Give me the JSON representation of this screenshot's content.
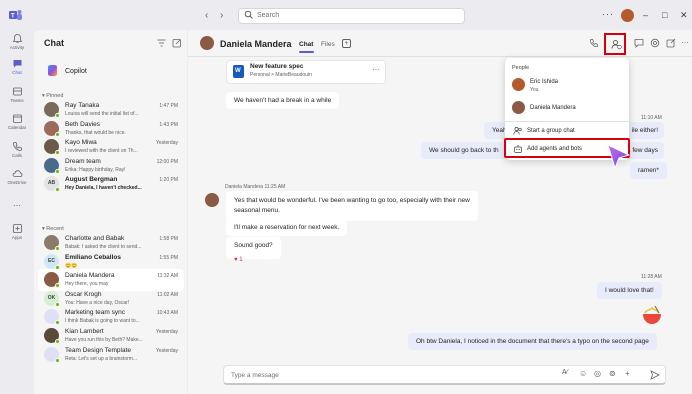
{
  "titlebar": {
    "search_placeholder": "Search",
    "more": "···",
    "win_min": "–",
    "win_max": "□",
    "win_close": "✕",
    "back": "‹",
    "forward": "›"
  },
  "rail": {
    "items": [
      {
        "label": "Activity",
        "icon": "bell-icon"
      },
      {
        "label": "Chat",
        "icon": "chat-icon"
      },
      {
        "label": "Teams",
        "icon": "teams-icon"
      },
      {
        "label": "Calendar",
        "icon": "calendar-icon"
      },
      {
        "label": "Calls",
        "icon": "phone-icon"
      },
      {
        "label": "OneDrive",
        "icon": "cloud-icon"
      },
      {
        "label": "···",
        "icon": "more-icon"
      },
      {
        "label": "Apps",
        "icon": "apps-icon"
      }
    ]
  },
  "chatlist": {
    "title": "Chat",
    "copilot": "Copilot",
    "pinned_header": "Pinned",
    "recent_header": "Recent",
    "chevron": "▾",
    "pinned": [
      {
        "name": "Ray Tanaka",
        "preview": "Louisa will send the initial list of...",
        "time": "1:47 PM",
        "color": "#7a6a5a",
        "initials": ""
      },
      {
        "name": "Beth Davies",
        "preview": "Thanks, that would be nice.",
        "time": "1:43 PM",
        "color": "#9c6b5a",
        "initials": ""
      },
      {
        "name": "Kayo Miwa",
        "preview": "I reviewed with the client on Th...",
        "time": "Yesterday",
        "color": "#6a5a4a",
        "initials": ""
      },
      {
        "name": "Dream team",
        "preview": "Erika: Happy birthday, Ray!",
        "time": "12:00 PM",
        "color": "#4a6a8a",
        "initials": ""
      },
      {
        "name": "August Bergman",
        "preview": "Hey Daniela, I haven't checked...",
        "time": "1:20 PM",
        "color": "#e3e3e3",
        "initials": "AB",
        "bold": true
      }
    ],
    "recent": [
      {
        "name": "Charlotte and Babak",
        "preview": "Babak: I asked the client to send...",
        "time": "1:58 PM",
        "color": "#8a7a6a",
        "initials": ""
      },
      {
        "name": "Emiliano Ceballos",
        "preview": "😊😊",
        "time": "1:55 PM",
        "color": "#d0e8f5",
        "initials": "EC",
        "bold": true
      },
      {
        "name": "Daniela Mandera",
        "preview": "Hey there, you may",
        "time": "11:32 AM",
        "color": "#8a5a44",
        "initials": "",
        "selected": true
      },
      {
        "name": "Oscar Krogh",
        "preview": "You: Have a nice day, Oscar!",
        "time": "11:02 AM",
        "color": "#d6efd0",
        "initials": "OK"
      },
      {
        "name": "Marketing team sync",
        "preview": "I think Babak is going to want to...",
        "time": "10:43 AM",
        "color": "#e0e0f5",
        "initials": ""
      },
      {
        "name": "Kian Lambert",
        "preview": "Have you run this by Beth? Make...",
        "time": "Yesterday",
        "color": "#5a4a3a",
        "initials": ""
      },
      {
        "name": "Team Design Template",
        "preview": "Reta: Let's set up a brainstorm...",
        "time": "Yesterday",
        "color": "#dfe0f5",
        "initials": ""
      }
    ]
  },
  "conversation": {
    "name": "Daniela Mandera",
    "tabs": {
      "chat": "Chat",
      "files": "Files",
      "add": "+"
    },
    "file": {
      "title": "New feature spec",
      "subtitle": "Personal > MarieBeaudouin",
      "more": "···",
      "letter": "W"
    },
    "messages": [
      {
        "text": "We haven't had a break in a while",
        "me": false
      },
      {
        "time": "11:10 AM"
      },
      {
        "text": "Yeah, I agree! I think we should take a break. Meeting a while either!",
        "me": true,
        "visible_tail": "ile either!"
      },
      {
        "text": "We should go back to the ramen place. It's been a few days",
        "me": true
      },
      {
        "text": "ramen*",
        "me": true
      },
      {
        "sender": "Daniela Mandera  11:25 AM"
      },
      {
        "text": "Yes that would be wonderful. I've been wanting to go too, especially with their new seasonal menu.",
        "me": false
      },
      {
        "text": "I'll make a reservation for next week.",
        "me": false
      },
      {
        "text": "Sound good?",
        "me": false
      },
      {
        "reaction": "♥ 1"
      },
      {
        "time": "11:28 AM"
      },
      {
        "text": "I would love that!",
        "me": true
      },
      {
        "text": "Oh btw Daniela, I noticed in the document that there's a typo on the second page",
        "me": true
      }
    ],
    "msg_yeah_prefix": "Yeah",
    "msg_yeah_tail": "ile either!",
    "msg_goback_prefix": "We should go back to th",
    "msg_goback_tail": "a few days",
    "msg_ramen": "ramen*",
    "msg_time_1": "11:10 AM",
    "msg_break": "We haven't had a break in a while",
    "msg_sender": "Daniela Mandera  11:25 AM",
    "msg_yes_line1": "Yes that would be wonderful. I've been wanting to go too, especially with their new",
    "msg_yes_line2": "seasonal menu.",
    "msg_reservation": "I'll make a reservation for next week.",
    "msg_sound": "Sound good?",
    "msg_reaction": "♥ 1",
    "msg_time_2": "11:28 AM",
    "msg_love": "I would love that!",
    "msg_typo": "Oh btw Daniela, I noticed in the document that there's a typo on the second page",
    "compose_placeholder": "Type a message"
  },
  "dropdown": {
    "header": "People",
    "people": [
      {
        "name": "Eric Ishida",
        "sub": "You",
        "color": "#b35b2c"
      },
      {
        "name": "Daniela Mandera",
        "sub": "",
        "color": "#8a5a44"
      }
    ],
    "start_group": "Start a group chat",
    "add_agents": "Add agents and bots"
  },
  "colors": {
    "accent": "#5b5fc7",
    "highlight": "#d9000d",
    "my_bubble": "#e8ebfa"
  }
}
